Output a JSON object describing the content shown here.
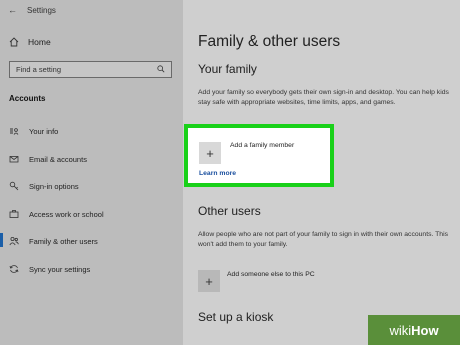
{
  "window": {
    "title": "Settings",
    "back_icon": "back-arrow-icon"
  },
  "sidebar": {
    "home_label": "Home",
    "search_placeholder": "Find a setting",
    "section": "Accounts",
    "items": [
      {
        "label": "Your info",
        "icon": "person-card-icon",
        "active": false
      },
      {
        "label": "Email & accounts",
        "icon": "mail-icon",
        "active": false
      },
      {
        "label": "Sign-in options",
        "icon": "key-icon",
        "active": false
      },
      {
        "label": "Access work or school",
        "icon": "briefcase-icon",
        "active": false
      },
      {
        "label": "Family & other users",
        "icon": "people-icon",
        "active": true
      },
      {
        "label": "Sync your settings",
        "icon": "sync-icon",
        "active": false
      }
    ]
  },
  "main": {
    "title": "Family & other users",
    "family": {
      "heading": "Your family",
      "description": "Add your family so everybody gets their own sign-in and desktop. You can help kids stay safe with appropriate websites, time limits, apps, and games.",
      "add_label": "Add a family member",
      "learn_more": "Learn more"
    },
    "other": {
      "heading": "Other users",
      "description": "Allow people who are not part of your family to sign in with their own accounts. This won't add them to your family.",
      "add_label": "Add someone else to this PC"
    },
    "kiosk_heading": "Set up a kiosk"
  },
  "watermark": {
    "prefix": "wiki",
    "suffix": "How"
  },
  "colors": {
    "highlight": "#19d119",
    "accent": "#1a5ea8",
    "link": "#1a4f9e"
  }
}
